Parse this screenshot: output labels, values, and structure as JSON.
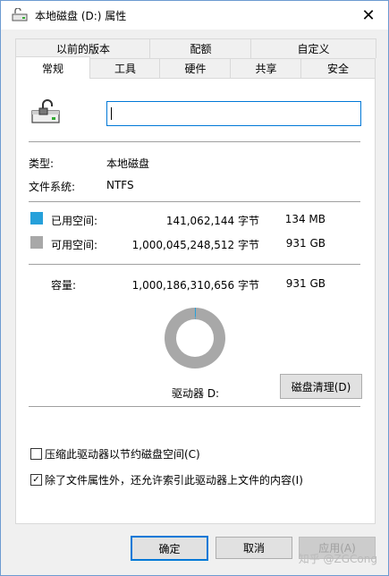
{
  "window": {
    "title": "本地磁盘 (D:) 属性",
    "close_glyph": "✕"
  },
  "tabs_row1": [
    "以前的版本",
    "配额",
    "自定义"
  ],
  "tabs_row2": [
    "常规",
    "工具",
    "硬件",
    "共享",
    "安全"
  ],
  "active_tab": "常规",
  "general": {
    "volume_label_value": "",
    "type_label": "类型:",
    "type_value": "本地磁盘",
    "fs_label": "文件系统:",
    "fs_value": "NTFS",
    "used_label": "已用空间:",
    "used_bytes": "141,062,144 字节",
    "used_size": "134 MB",
    "used_color": "#26a0da",
    "free_label": "可用空间:",
    "free_bytes": "1,000,045,248,512 字节",
    "free_size": "931 GB",
    "free_color": "#a8a8a8",
    "capacity_label": "容量:",
    "capacity_bytes": "1,000,186,310,656 字节",
    "capacity_size": "931 GB",
    "drive_label": "驱动器 D:",
    "cleanup_button": "磁盘清理(D)",
    "compress_label": "压缩此驱动器以节约磁盘空间(C)",
    "compress_checked": false,
    "index_label": "除了文件属性外，还允许索引此驱动器上文件的内容(I)",
    "index_checked": true,
    "check_glyph": "✓"
  },
  "buttons": {
    "ok": "确定",
    "cancel": "取消",
    "apply": "应用(A)"
  },
  "watermark": "知乎 @ZGCong"
}
